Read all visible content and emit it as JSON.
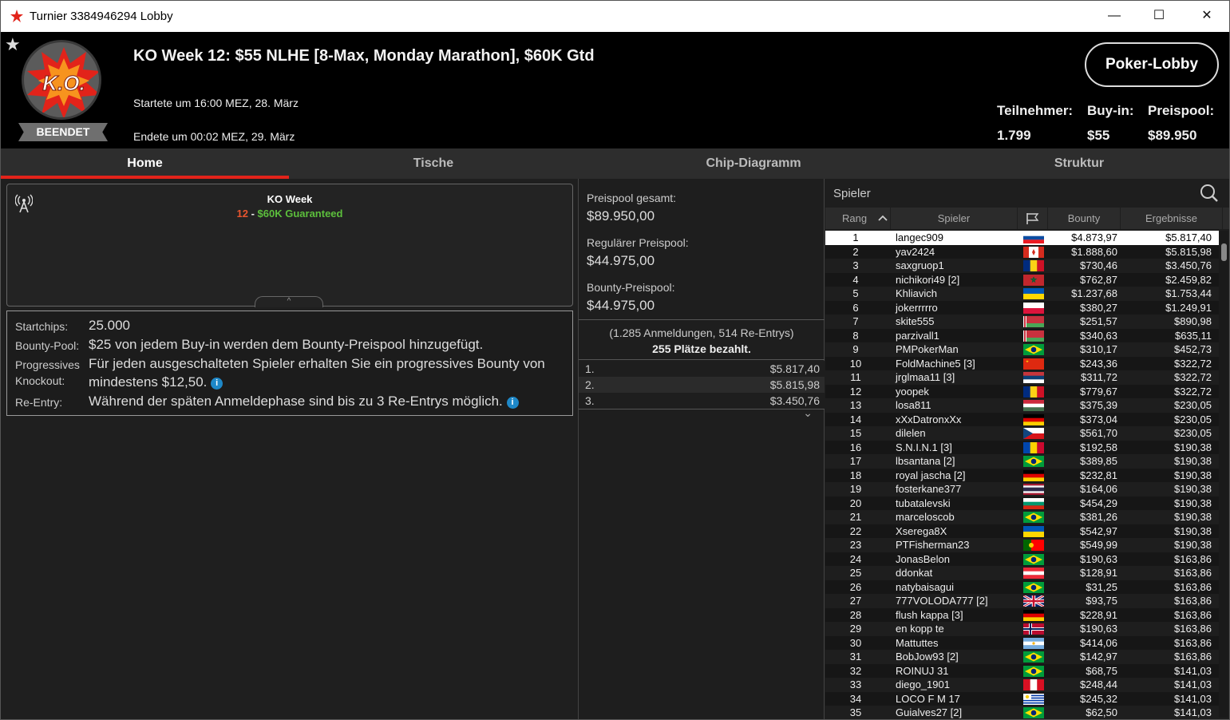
{
  "window": {
    "title": "Turnier 3384946294 Lobby",
    "minimize": "—",
    "maximize": "☐",
    "close": "✕"
  },
  "header": {
    "badge_text": "K.O.",
    "status": "BEENDET",
    "title": "KO Week 12: $55 NLHE [8-Max, Monday Marathon], $60K Gtd",
    "started": "Startete um 16:00 MEZ, 28. März",
    "ended": "Endete um 00:02 MEZ, 29. März",
    "lobby_button": "Poker-Lobby",
    "stats": [
      {
        "label": "Teilnehmer:",
        "value": "1.799"
      },
      {
        "label": "Buy-in:",
        "value": "$55"
      },
      {
        "label": "Preispool:",
        "value": "$89.950"
      }
    ]
  },
  "tabs": [
    {
      "label": "Home"
    },
    {
      "label": "Tische"
    },
    {
      "label": "Chip-Diagramm"
    },
    {
      "label": "Struktur"
    }
  ],
  "name_box": {
    "line1": "KO Week",
    "line2_number": "12",
    "line2_sep": " - ",
    "line2_text": "$60K Guaranteed",
    "collapse": "^"
  },
  "info": [
    {
      "label": "Startchips:",
      "value": "25.000"
    },
    {
      "label": "Bounty-Pool:",
      "value": "$25 von jedem Buy-in werden dem Bounty-Preispool hinzugefügt."
    },
    {
      "label": "Progressives Knockout:",
      "value": "Für jeden ausgeschalteten Spieler erhalten Sie ein progressives Bounty von mindestens $12,50."
    },
    {
      "label": "Re-Entry:",
      "value": "Während der späten Anmeldephase sind bis zu 3 Re-Entrys möglich."
    }
  ],
  "info_icon": "i",
  "prize": {
    "total_label": "Preispool gesamt:",
    "total_value": "$89.950,00",
    "regular_label": "Regulärer Preispool:",
    "regular_value": "$44.975,00",
    "bounty_label": "Bounty-Preispool:",
    "bounty_value": "$44.975,00",
    "entries": "(1.285 Anmeldungen, 514 Re-Entrys)",
    "paid": "255 Plätze bezahlt.",
    "payouts": [
      {
        "place": "1.",
        "amount": "$5.817,40"
      },
      {
        "place": "2.",
        "amount": "$5.815,98"
      },
      {
        "place": "3.",
        "amount": "$3.450,76"
      }
    ],
    "more": "⌄"
  },
  "players": {
    "search_placeholder": "Spieler",
    "columns": {
      "rank": "Rang",
      "player": "Spieler",
      "bounty": "Bounty",
      "result": "Ergebnisse"
    },
    "rows": [
      {
        "r": "1",
        "p": "langec909",
        "f": "si",
        "b": "$4.873,97",
        "e": "$5.817,40"
      },
      {
        "r": "2",
        "p": "yav2424",
        "f": "ca",
        "b": "$1.888,60",
        "e": "$5.815,98"
      },
      {
        "r": "3",
        "p": "saxgruop1",
        "f": "ro",
        "b": "$730,46",
        "e": "$3.450,76"
      },
      {
        "r": "4",
        "p": "nichikori49 [2]",
        "f": "ma",
        "b": "$762,87",
        "e": "$2.459,82"
      },
      {
        "r": "5",
        "p": "Khliavich",
        "f": "ua",
        "b": "$1.237,68",
        "e": "$1.753,44"
      },
      {
        "r": "6",
        "p": "jokerrrrro",
        "f": "pl",
        "b": "$380,27",
        "e": "$1.249,91"
      },
      {
        "r": "7",
        "p": "skite555",
        "f": "by",
        "b": "$251,57",
        "e": "$890,98"
      },
      {
        "r": "8",
        "p": "parzivall1",
        "f": "by",
        "b": "$340,63",
        "e": "$635,11"
      },
      {
        "r": "9",
        "p": "PMPokerMan",
        "f": "br",
        "b": "$310,17",
        "e": "$452,73"
      },
      {
        "r": "10",
        "p": "FoldMachine5 [3]",
        "f": "cn",
        "b": "$243,36",
        "e": "$322,72"
      },
      {
        "r": "11",
        "p": "jrglmaa11 [3]",
        "f": "rs",
        "b": "$311,72",
        "e": "$322,72"
      },
      {
        "r": "12",
        "p": "yoopek",
        "f": "ro",
        "b": "$779,67",
        "e": "$322,72"
      },
      {
        "r": "13",
        "p": "losa811",
        "f": "hu",
        "b": "$375,39",
        "e": "$230,05"
      },
      {
        "r": "14",
        "p": "xXxDatronxXx",
        "f": "de",
        "b": "$373,04",
        "e": "$230,05"
      },
      {
        "r": "15",
        "p": "dilelen",
        "f": "cz",
        "b": "$561,70",
        "e": "$230,05"
      },
      {
        "r": "16",
        "p": "S.N.I.N.1 [3]",
        "f": "md",
        "b": "$192,58",
        "e": "$190,38"
      },
      {
        "r": "17",
        "p": "lbsantana [2]",
        "f": "br",
        "b": "$389,85",
        "e": "$190,38"
      },
      {
        "r": "18",
        "p": "royal jascha [2]",
        "f": "de",
        "b": "$232,81",
        "e": "$190,38"
      },
      {
        "r": "19",
        "p": "fosterkane377",
        "f": "th",
        "b": "$164,06",
        "e": "$190,38"
      },
      {
        "r": "20",
        "p": "tubatalevski",
        "f": "bg",
        "b": "$454,29",
        "e": "$190,38"
      },
      {
        "r": "21",
        "p": "marceloscob",
        "f": "br",
        "b": "$381,26",
        "e": "$190,38"
      },
      {
        "r": "22",
        "p": "Xserega8X",
        "f": "ua",
        "b": "$542,97",
        "e": "$190,38"
      },
      {
        "r": "23",
        "p": "PTFisherman23",
        "f": "pt",
        "b": "$549,99",
        "e": "$190,38"
      },
      {
        "r": "24",
        "p": "JonasBelon",
        "f": "br",
        "b": "$190,63",
        "e": "$163,86"
      },
      {
        "r": "25",
        "p": "ddonkat",
        "f": "at",
        "b": "$128,91",
        "e": "$163,86"
      },
      {
        "r": "26",
        "p": "natybaisagui",
        "f": "br",
        "b": "$31,25",
        "e": "$163,86"
      },
      {
        "r": "27",
        "p": "777VOLODA777 [2]",
        "f": "gb",
        "b": "$93,75",
        "e": "$163,86"
      },
      {
        "r": "28",
        "p": "flush kappa [3]",
        "f": "de",
        "b": "$228,91",
        "e": "$163,86"
      },
      {
        "r": "29",
        "p": "en kopp te",
        "f": "no",
        "b": "$190,63",
        "e": "$163,86"
      },
      {
        "r": "30",
        "p": "Mattuttes",
        "f": "ar",
        "b": "$414,06",
        "e": "$163,86"
      },
      {
        "r": "31",
        "p": "BobJow93 [2]",
        "f": "br",
        "b": "$142,97",
        "e": "$163,86"
      },
      {
        "r": "32",
        "p": "ROINUJ 31",
        "f": "br",
        "b": "$68,75",
        "e": "$141,03"
      },
      {
        "r": "33",
        "p": "diego_1901",
        "f": "pe",
        "b": "$248,44",
        "e": "$141,03"
      },
      {
        "r": "34",
        "p": "LOCO F M 17",
        "f": "uy",
        "b": "$245,32",
        "e": "$141,03"
      },
      {
        "r": "35",
        "p": "Guialves27 [2]",
        "f": "br",
        "b": "$62,50",
        "e": "$141,03"
      }
    ]
  }
}
